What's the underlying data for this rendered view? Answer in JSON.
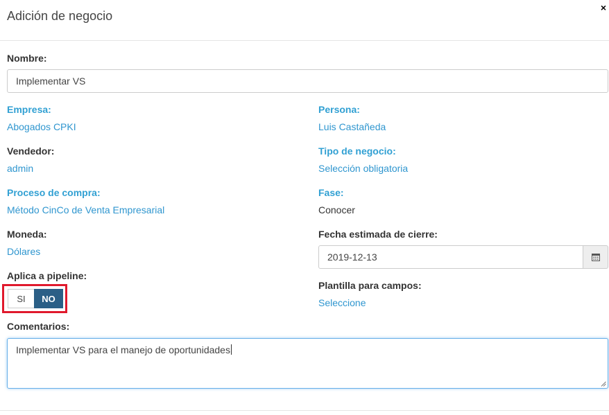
{
  "modal": {
    "title": "Adición de negocio",
    "close_label": "×"
  },
  "fields": {
    "nombre": {
      "label": "Nombre:",
      "value": "Implementar VS"
    },
    "empresa": {
      "label": "Empresa:",
      "value": "Abogados CPKI"
    },
    "persona": {
      "label": "Persona:",
      "value": "Luis Castañeda"
    },
    "vendedor": {
      "label": "Vendedor:",
      "value": "admin"
    },
    "tipo_negocio": {
      "label": "Tipo de negocio:",
      "value": "Selección obligatoria"
    },
    "proceso_compra": {
      "label": "Proceso de compra:",
      "value": "Método CinCo de Venta Empresarial"
    },
    "fase": {
      "label": "Fase:",
      "value": "Conocer"
    },
    "moneda": {
      "label": "Moneda:",
      "value": "Dólares"
    },
    "fecha_cierre": {
      "label": "Fecha estimada de cierre:",
      "value": "2019-12-13",
      "icon": "calendar-icon"
    },
    "pipeline": {
      "label": "Aplica a pipeline:",
      "yes_label": "SI",
      "no_label": "NO",
      "selected": "NO"
    },
    "plantilla": {
      "label": "Plantilla para campos:",
      "value": "Seleccione"
    },
    "comentarios": {
      "label": "Comentarios:",
      "value": "Implementar VS para el manejo de oportunidades"
    }
  },
  "colors": {
    "link": "#2f96cf",
    "label_accent": "#31a0d3",
    "toggle_active": "#2b5f86",
    "highlight": "#e0192c",
    "focus_border": "#66afe9"
  }
}
